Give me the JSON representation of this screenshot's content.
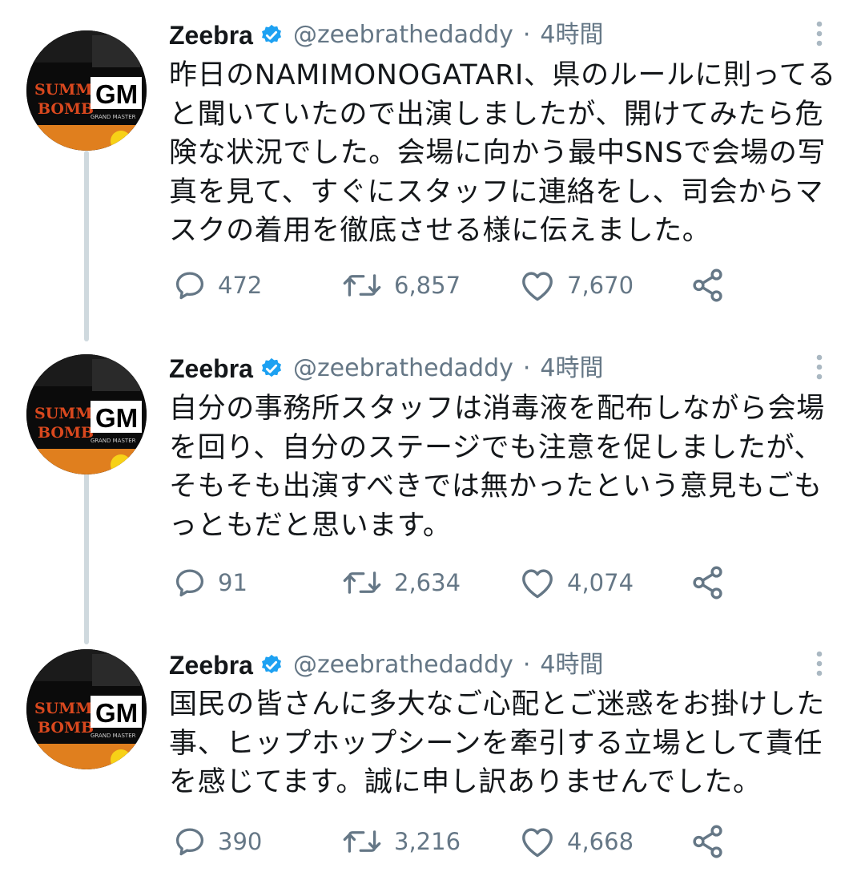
{
  "tweets": [
    {
      "name": "Zeebra",
      "handle": "@zeebrathedaddy",
      "separator": "·",
      "time": "4時間",
      "text": "昨日のNAMIMONOGATARI、県のルールに則ってると聞いていたので出演しましたが、開けてみたら危険な状況でした。会場に向かう最中SNSで会場の写真を見て、すぐにスタッフに連絡をし、司会からマスクの着用を徹底させる様に伝えました。",
      "replies": "472",
      "retweets": "6,857",
      "likes": "7,670"
    },
    {
      "name": "Zeebra",
      "handle": "@zeebrathedaddy",
      "separator": "·",
      "time": "4時間",
      "text": "自分の事務所スタッフは消毒液を配布しながら会場を回り、自分のステージでも注意を促しましたが、そもそも出演すべきでは無かったという意見もごもっともだと思います。",
      "replies": "91",
      "retweets": "2,634",
      "likes": "4,074"
    },
    {
      "name": "Zeebra",
      "handle": "@zeebrathedaddy",
      "separator": "·",
      "time": "4時間",
      "text": "国民の皆さんに多大なご心配とご迷惑をお掛けした事、ヒップホップシーンを牽引する立場として責任を感じてます。誠に申し訳ありませんでした。",
      "replies": "390",
      "retweets": "3,216",
      "likes": "4,668"
    }
  ],
  "avatar_art": {
    "line1": "SUMMER",
    "line2": "BOMB",
    "badge": "GM",
    "sub": "GRAND MASTER"
  },
  "colors": {
    "text": "#14171a",
    "secondary": "#657786",
    "verified": "#1da1f2",
    "thread_line": "#cfd9de",
    "icon": "#657786"
  },
  "icons": {
    "reply": "speech-bubble-icon",
    "retweet": "retweet-icon",
    "like": "heart-icon",
    "share": "share-icon",
    "more": "vertical-dots-icon",
    "verified": "verified-badge-icon"
  }
}
